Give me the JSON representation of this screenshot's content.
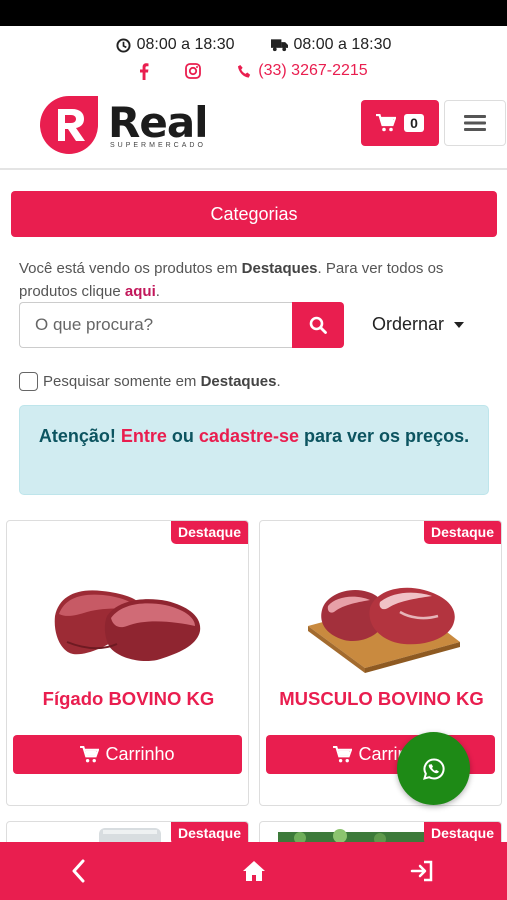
{
  "top_info": {
    "hours_store": "08:00 a 18:30",
    "hours_delivery": "08:00 a 18:30",
    "phone": "(33) 3267-2215"
  },
  "icons": {
    "clock": "clock-icon",
    "truck": "truck-icon",
    "facebook": "facebook-icon",
    "instagram": "instagram-icon",
    "phone": "phone-icon",
    "cart": "cart-icon",
    "menu": "hamburger-menu-icon",
    "search": "search-icon",
    "whatsapp": "whatsapp-icon",
    "back": "chevron-left-icon",
    "home": "home-icon",
    "logout": "sign-out-icon"
  },
  "header": {
    "logo_name": "Real",
    "logo_sub": "SUPERMERCADO",
    "cart_count": "0"
  },
  "categories_button": "Categorias",
  "info": {
    "prefix": "Você está vendo os produtos em ",
    "section": "Destaques",
    "middle": ". Para ver todos os produtos clique ",
    "link": "aqui",
    "suffix": "."
  },
  "search": {
    "placeholder": "O que procura?"
  },
  "order_label": "Ordernar",
  "checkbox": {
    "label_prefix": "Pesquisar somente em ",
    "label_section": "Destaques",
    "label_suffix": ".",
    "checked": false
  },
  "alert": {
    "part1": "Atenção! ",
    "entre": "Entre",
    "ou": " ou ",
    "cadastre": "cadastre-se",
    "part2": " para ver os preços."
  },
  "products": [
    {
      "badge": "Destaque",
      "name": "Fígado BOVINO KG",
      "button": "Carrinho"
    },
    {
      "badge": "Destaque",
      "name": "MUSCULO BOVINO KG",
      "button": "Carrinho"
    }
  ],
  "products_row2": [
    {
      "badge": "Destaque"
    },
    {
      "badge": "Destaque"
    }
  ],
  "colors": {
    "brand": "#e91e4f",
    "alert_bg": "#d1ecf1",
    "alert_text": "#0c5460",
    "whatsapp": "#1e8a16"
  }
}
